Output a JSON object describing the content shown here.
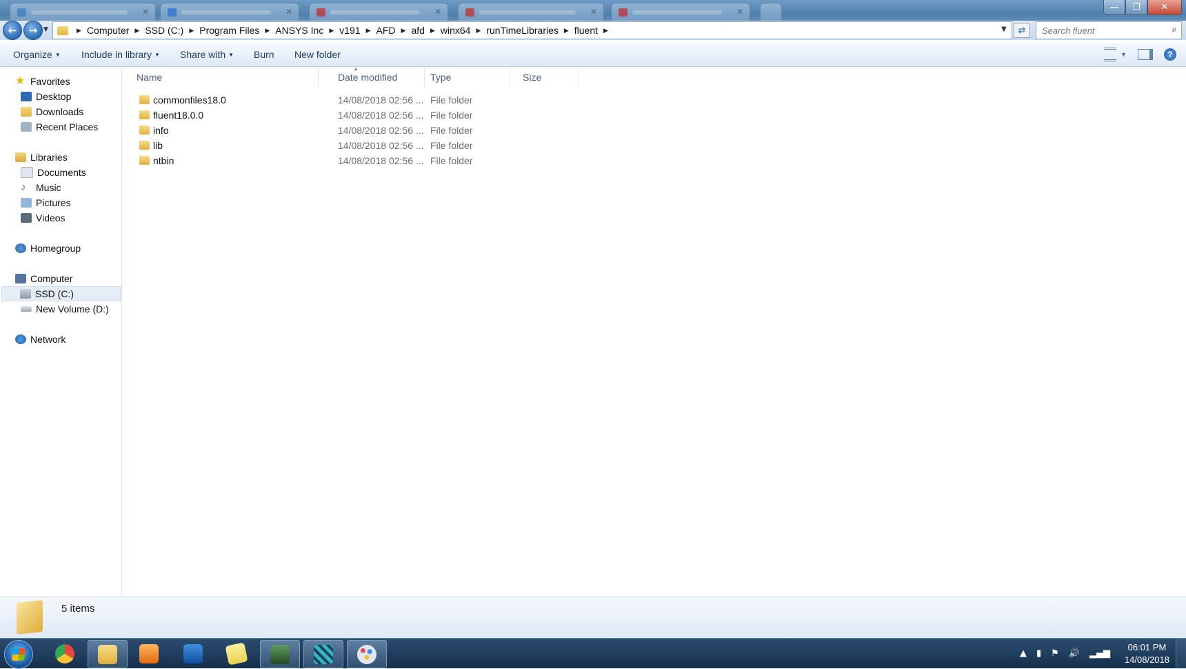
{
  "window": {
    "title_bar_buttons": {
      "minimize": "—",
      "maximize": "❐",
      "close": "✕"
    },
    "tabs": [
      {
        "fav_color": "#4f86c6"
      },
      {
        "fav_color": "#3b7dd8"
      },
      {
        "fav_color": "#d23b3b"
      },
      {
        "fav_color": "#d23b3b"
      },
      {
        "fav_color": "#d23b3b"
      }
    ]
  },
  "address": {
    "back_icon": "←",
    "forward_icon": "→",
    "crumbs": [
      "Computer",
      "SSD (C:)",
      "Program Files",
      "ANSYS Inc",
      "v191",
      "AFD",
      "afd",
      "winx64",
      "runTimeLibraries",
      "fluent"
    ],
    "refresh_icon": "⇄",
    "search_placeholder": "Search fluent",
    "search_icon": "⌕"
  },
  "toolbar": {
    "organize": "Organize",
    "include_in_library": "Include in library",
    "share_with": "Share with",
    "burn": "Burn",
    "new_folder": "New folder",
    "help": "?"
  },
  "nav": {
    "favorites": "Favorites",
    "desktop": "Desktop",
    "downloads": "Downloads",
    "recent_places": "Recent Places",
    "libraries": "Libraries",
    "documents": "Documents",
    "music": "Music",
    "pictures": "Pictures",
    "videos": "Videos",
    "homegroup": "Homegroup",
    "computer": "Computer",
    "ssd": "SSD (C:)",
    "new_volume": "New Volume (D:)",
    "network": "Network"
  },
  "columns": {
    "name": "Name",
    "date_modified": "Date modified",
    "type": "Type",
    "size": "Size"
  },
  "files": [
    {
      "name": "commonfiles18.0",
      "date": "14/08/2018 02:56 ...",
      "type": "File folder"
    },
    {
      "name": "fluent18.0.0",
      "date": "14/08/2018 02:56 ...",
      "type": "File folder"
    },
    {
      "name": "info",
      "date": "14/08/2018 02:56 ...",
      "type": "File folder"
    },
    {
      "name": "lib",
      "date": "14/08/2018 02:56 ...",
      "type": "File folder"
    },
    {
      "name": "ntbin",
      "date": "14/08/2018 02:56 ...",
      "type": "File folder"
    }
  ],
  "status": {
    "item_count": "5 items"
  },
  "taskbar": {
    "time": "06:01 PM",
    "date": "14/08/2018",
    "tray_icons": [
      "▲",
      "▮",
      "⚑",
      "🔊",
      "▂▄▆"
    ],
    "apps": [
      {
        "name": "chrome",
        "color": "#e8453c"
      },
      {
        "name": "explorer",
        "color": "#f2c94c"
      },
      {
        "name": "media-player",
        "color": "#f08a24"
      },
      {
        "name": "outlook",
        "color": "#1f6fc5"
      },
      {
        "name": "sticky-notes",
        "color": "#f4e06d"
      },
      {
        "name": "terminal-app",
        "color": "#3f7a3f"
      },
      {
        "name": "grid-app",
        "color": "#2fb7c2"
      },
      {
        "name": "paint",
        "color": "#c9d8e8"
      }
    ]
  }
}
